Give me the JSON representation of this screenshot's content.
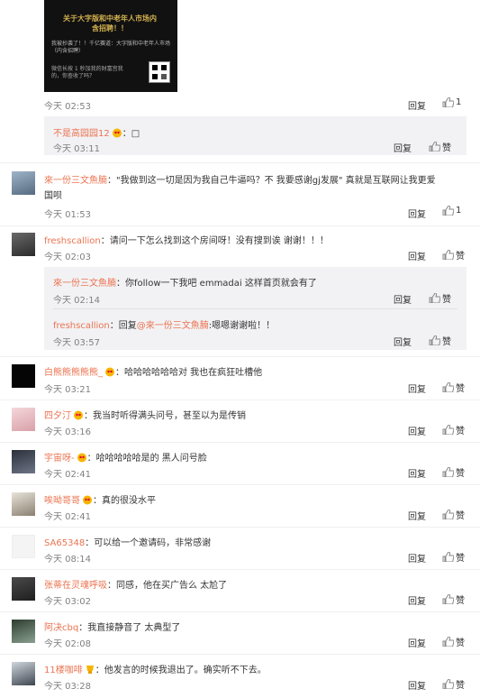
{
  "labels": {
    "reply": "回复",
    "like": "赞"
  },
  "embedded_image": {
    "title": "关于大字版和中老年人市场内含招聘！！",
    "body": "我被抄袭了！！千亿赛道：大字版和中老年人市场（内含招聘）",
    "footer": "微信长按 1 秒加我的财富宫我的，你查收了吗？"
  },
  "comments": [
    {
      "time": "今天 02:53",
      "like": "1"
    },
    {
      "user": "不是高园园12",
      "sep": "：",
      "text": "□",
      "time": "今天 03:11",
      "like": "赞"
    },
    {
      "user": "來一份三文魚腩",
      "sep": "：",
      "text1": "\"我做到这一切是因为我自己牛逼吗？不 我要感谢gj发展\" 真就是互联网让我更爱",
      "text2": "国呗",
      "time": "今天 01:53",
      "like": "1"
    },
    {
      "user": "freshscallion",
      "sep": "：",
      "text": "请问一下怎么找到这个房间呀！没有搜到诶 谢谢！！！",
      "time": "今天 02:03",
      "like": "赞"
    },
    {
      "user": "來一份三文魚腩",
      "sep": "：",
      "text": "你follow一下我吧 emmadai 这样首页就会有了",
      "time": "今天 02:14",
      "like": "赞"
    },
    {
      "user": "freshscallion",
      "sep": "：",
      "prefix": "回复",
      "mention": "@來一份三文魚腩",
      "text": ":嗯嗯谢谢啦！！",
      "time": "今天 03:57",
      "like": "赞"
    },
    {
      "user": "白熊熊熊熊熊_",
      "sep": "：",
      "text": "哈哈哈哈哈哈对 我也在疯狂吐槽他",
      "time": "今天 03:21",
      "like": "赞"
    },
    {
      "user": "四夕汀",
      "sep": "：",
      "text": "我当时听得满头问号，甚至以为是传销",
      "time": "今天 03:16",
      "like": "赞"
    },
    {
      "user": "宇宙呀-",
      "sep": "：",
      "text": "哈哈哈哈哈是的  黑人问号脸",
      "time": "今天 02:41",
      "like": "赞"
    },
    {
      "user": "唉呦哥哥",
      "sep": "：",
      "text": "真的很没水平",
      "time": "今天 02:41",
      "like": "赞"
    },
    {
      "user": "SA65348",
      "sep": "：",
      "text": "可以给一个邀请码，非常感谢",
      "time": "今天 08:14",
      "like": "赞"
    },
    {
      "user": "张蒂在灵魂呼吸",
      "sep": "：",
      "text": "同感，他在买广告么 太尬了",
      "time": "今天 03:02",
      "like": "赞"
    },
    {
      "user": "阿决cbq",
      "sep": "：",
      "text": "我直接静音了 太典型了",
      "time": "今天 02:08",
      "like": "赞"
    },
    {
      "user": "11楼咖啡",
      "sep": "：",
      "text": "他发言的时候我退出了。确实听不下去。",
      "time": "今天 03:28",
      "like": "赞"
    }
  ]
}
